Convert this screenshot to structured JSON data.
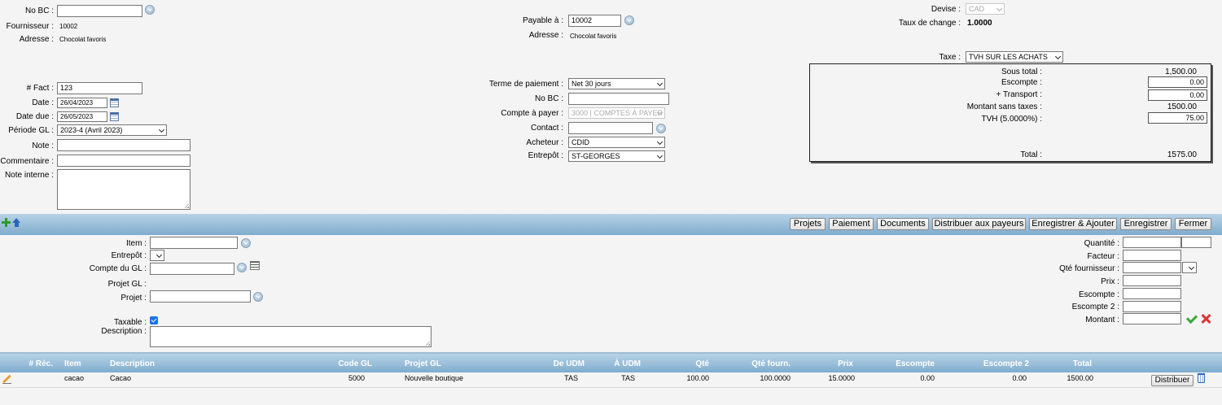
{
  "header": {
    "no_bc_label": "No BC :",
    "no_bc_value": "",
    "fournisseur_label": "Fournisseur :",
    "fournisseur_value": "10002",
    "adresse_label": "Adresse :",
    "adresse_value": "Chocolat favoris",
    "payable_label": "Payable à :",
    "payable_value": "10002",
    "adresse2_label": "Adresse :",
    "adresse2_value": "Chocolat favoris",
    "devise_label": "Devise :",
    "devise_value": "CAD",
    "taux_label": "Taux de change :",
    "taux_value": "1.0000"
  },
  "invoice": {
    "fact_label": "# Fact :",
    "fact_value": "123",
    "date_label": "Date :",
    "date_value": "26/04/2023",
    "date_due_label": "Date due :",
    "date_due_value": "26/05/2023",
    "periode_label": "Période GL :",
    "periode_value": "2023-4 (Avril 2023)",
    "note_label": "Note :",
    "commentaire_label": "Commentaire :",
    "note_interne_label": "Note interne :"
  },
  "middle": {
    "terme_label": "Terme de paiement :",
    "terme_value": "Net 30 jours",
    "no_bc_label": "No BC :",
    "compte_label": "Compte à payer :",
    "compte_value": "3000 | COMPTES À PAYER",
    "contact_label": "Contact :",
    "acheteur_label": "Acheteur :",
    "acheteur_value": "CDID",
    "entrepot_label": "Entrepôt :",
    "entrepot_value": "ST-GEORGES"
  },
  "totals": {
    "taxe_label": "Taxe :",
    "taxe_value": "TVH SUR LES ACHATS",
    "sous_total_label": "Sous total :",
    "sous_total_value": "1,500.00",
    "escompte_label": "Escompte :",
    "escompte_value": "0.00",
    "transport_label": "+ Transport :",
    "transport_value": "0.00",
    "montant_label": "Montant sans taxes :",
    "montant_value": "1500.00",
    "tvh_label": "TVH (5.0000%) :",
    "tvh_value": "75.00",
    "total_label": "Total :",
    "total_value": "1575.00"
  },
  "toolbar": {
    "buttons": [
      "Projets",
      "Paiement",
      "Documents",
      "Distribuer aux payeurs",
      "Enregistrer & Ajouter",
      "Enregistrer",
      "Fermer"
    ]
  },
  "line_form": {
    "item_label": "Item :",
    "entrepot_label": "Entrepôt :",
    "compte_gl_label": "Compte du GL :",
    "projet_gl_label": "Projet GL :",
    "projet_label": "Projet :",
    "taxable_label": "Taxable :",
    "description_label": "Description :",
    "quantite_label": "Quantité :",
    "facteur_label": "Facteur :",
    "qte_fourn_label": "Qté fournisseur :",
    "prix_label": "Prix :",
    "escompte_label": "Escompte :",
    "escompte2_label": "Escompte 2 :",
    "montant_label": "Montant :"
  },
  "table": {
    "headers": [
      "# Réc.",
      "Item",
      "Description",
      "Code GL",
      "Projet GL",
      "De UDM",
      "À UDM",
      "Qté",
      "Qté fourn.",
      "Prix",
      "Escompte",
      "Escompte 2",
      "Total"
    ],
    "rows": [
      {
        "rec": "",
        "item": "cacao",
        "description": "Cacao",
        "code_gl": "5000",
        "projet_gl": "Nouvelle boutique",
        "de_udm": "TAS",
        "a_udm": "TAS",
        "qte": "100.00",
        "qte_fourn": "100.0000",
        "prix": "15.0000",
        "escompte": "0.00",
        "escompte2": "0.00",
        "total": "1500.00",
        "action": "Distribuer"
      }
    ]
  },
  "colors": {
    "bar": "#7faccd",
    "background": "#f4f4f4"
  }
}
